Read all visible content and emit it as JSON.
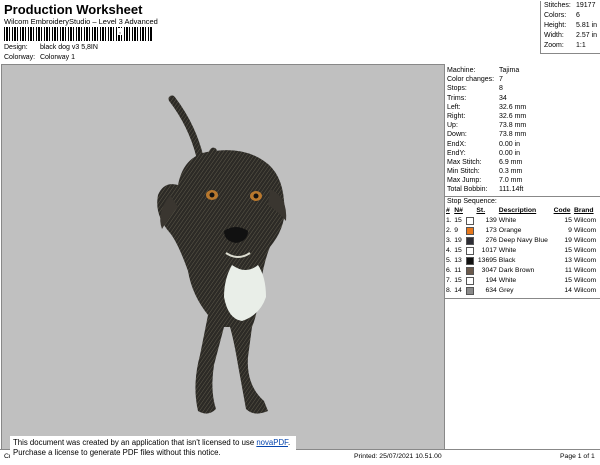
{
  "header": {
    "title": "Production Worksheet",
    "subtitle": "Wilcom EmbroideryStudio – Level 3 Advanced",
    "barcode_number": ",",
    "design_label": "Design:",
    "design_value": "black dog v3 5,8IN",
    "colorway_label": "Colorway:",
    "colorway_value": "Colorway 1"
  },
  "stats": [
    {
      "label": "Stitches:",
      "value": "19177"
    },
    {
      "label": "Colors:",
      "value": "6"
    },
    {
      "label": "Height:",
      "value": "5.81 in"
    },
    {
      "label": "Width:",
      "value": "2.57 in"
    },
    {
      "label": "Zoom:",
      "value": "1:1"
    }
  ],
  "machine_info": [
    {
      "label": "Machine:",
      "value": "Tajima"
    },
    {
      "label": "Color changes:",
      "value": "7"
    },
    {
      "label": "Stops:",
      "value": "8"
    },
    {
      "label": "Trims:",
      "value": "34"
    },
    {
      "label": "Left:",
      "value": "32.6 mm"
    },
    {
      "label": "Right:",
      "value": "32.6 mm"
    },
    {
      "label": "Up:",
      "value": "73.8 mm"
    },
    {
      "label": "Down:",
      "value": "73.8 mm"
    },
    {
      "label": "EndX:",
      "value": "0.00 in"
    },
    {
      "label": "EndY:",
      "value": "0.00 in"
    },
    {
      "label": "Max Stitch:",
      "value": "6.9 mm"
    },
    {
      "label": "Min Stitch:",
      "value": "0.3 mm"
    },
    {
      "label": "Max Jump:",
      "value": "7.0 mm"
    },
    {
      "label": "Total Bobbin:",
      "value": "111.14ft"
    }
  ],
  "stop_sequence": {
    "title": "Stop Sequence:",
    "headers": [
      "#",
      "N#",
      "St.",
      "Description",
      "Code",
      "Brand"
    ],
    "rows": [
      {
        "num": "1.",
        "n": "15",
        "color": "#ffffff",
        "st": "139",
        "desc": "White",
        "code": "15",
        "brand": "Wilcom"
      },
      {
        "num": "2.",
        "n": "9",
        "color": "#e8781c",
        "st": "173",
        "desc": "Orange",
        "code": "9",
        "brand": "Wilcom"
      },
      {
        "num": "3.",
        "n": "19",
        "color": "#2e2e36",
        "st": "276",
        "desc": "Deep Navy Blue",
        "code": "19",
        "brand": "Wilcom"
      },
      {
        "num": "4.",
        "n": "15",
        "color": "#ffffff",
        "st": "1017",
        "desc": "White",
        "code": "15",
        "brand": "Wilcom"
      },
      {
        "num": "5.",
        "n": "13",
        "color": "#111111",
        "st": "13695",
        "desc": "Black",
        "code": "13",
        "brand": "Wilcom"
      },
      {
        "num": "6.",
        "n": "11",
        "color": "#6b5a4c",
        "st": "3047",
        "desc": "Dark Brown",
        "code": "11",
        "brand": "Wilcom"
      },
      {
        "num": "7.",
        "n": "15",
        "color": "#ffffff",
        "st": "194",
        "desc": "White",
        "code": "15",
        "brand": "Wilcom"
      },
      {
        "num": "8.",
        "n": "14",
        "color": "#8a8a8a",
        "st": "634",
        "desc": "Grey",
        "code": "14",
        "brand": "Wilcom"
      }
    ]
  },
  "footer": {
    "cr": "Cr",
    "printed": "Printed: 25/07/2021 10.51.00",
    "page": "Page 1 of 1"
  },
  "notice": {
    "line1_prefix": "This document was created by an application that isn't licensed to use",
    "link": "novaPDF",
    "line1_suffix": ".",
    "line2": "Purchase a license to generate PDF files without this notice."
  }
}
